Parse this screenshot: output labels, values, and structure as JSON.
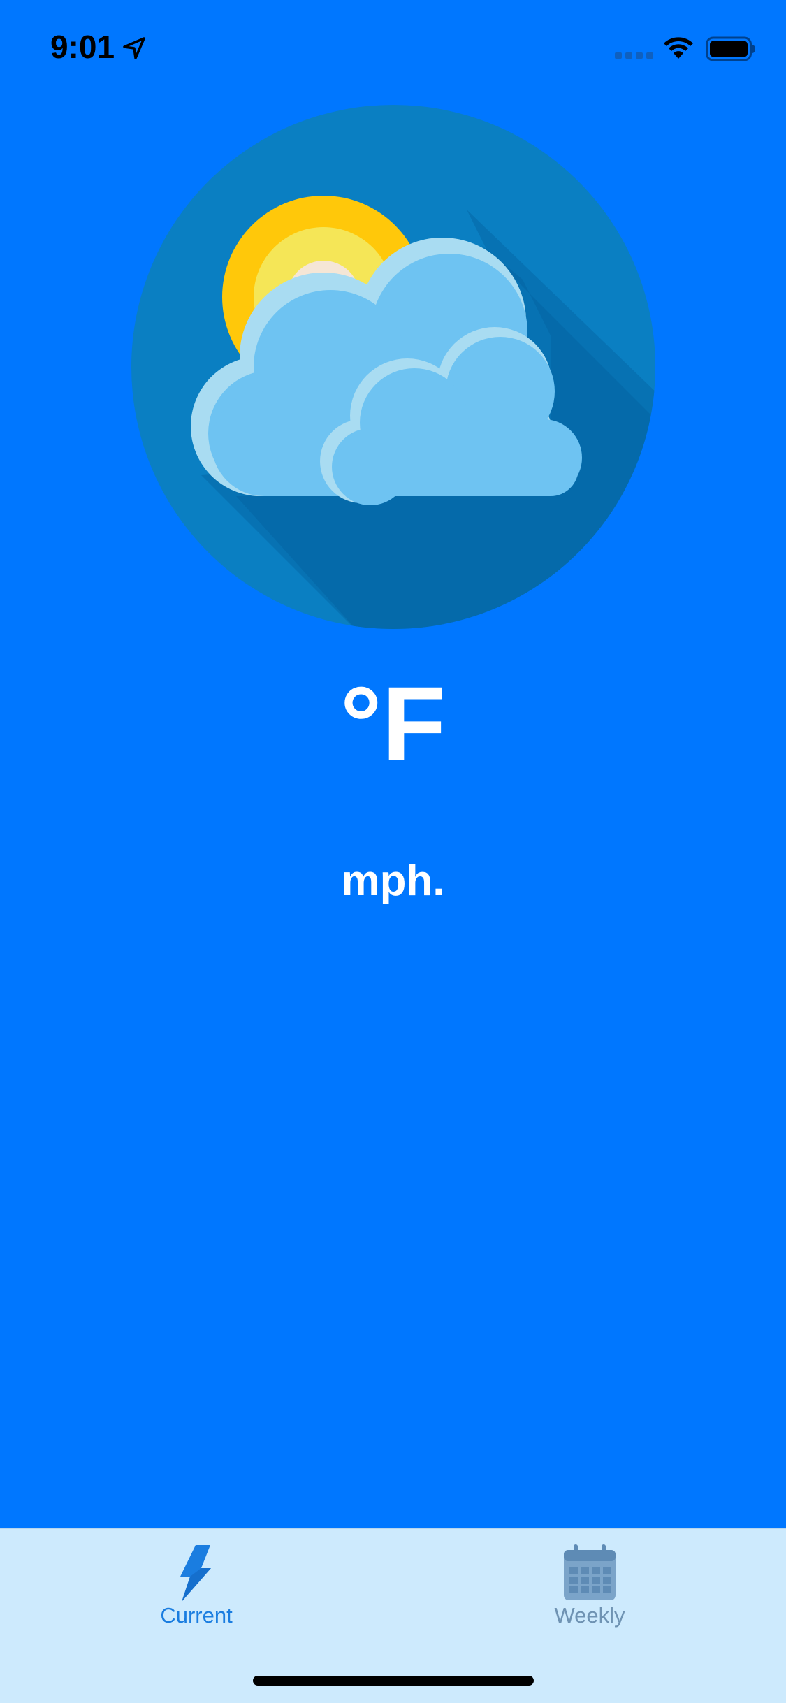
{
  "status_bar": {
    "time": "9:01",
    "location_icon": "location-arrow-icon",
    "signal_icon": "cellular-signal-icon",
    "wifi_icon": "wifi-icon",
    "battery_icon": "battery-icon"
  },
  "weather": {
    "icon": "partly-cloudy-icon",
    "temperature": "°F",
    "wind": "mph."
  },
  "tab_bar": {
    "tabs": [
      {
        "label": "Current",
        "icon": "lightning-bolt-icon",
        "selected": true
      },
      {
        "label": "Weekly",
        "icon": "calendar-icon",
        "selected": false
      }
    ]
  },
  "colors": {
    "background": "#0077ff",
    "tab_bar_background": "#cdeafd",
    "tab_selected": "#1a7de0",
    "tab_unselected": "#6f93b3",
    "icon_circle": "#0a7fc2",
    "sun_outer": "#ffc80a",
    "cloud": "#6ec3f2"
  }
}
